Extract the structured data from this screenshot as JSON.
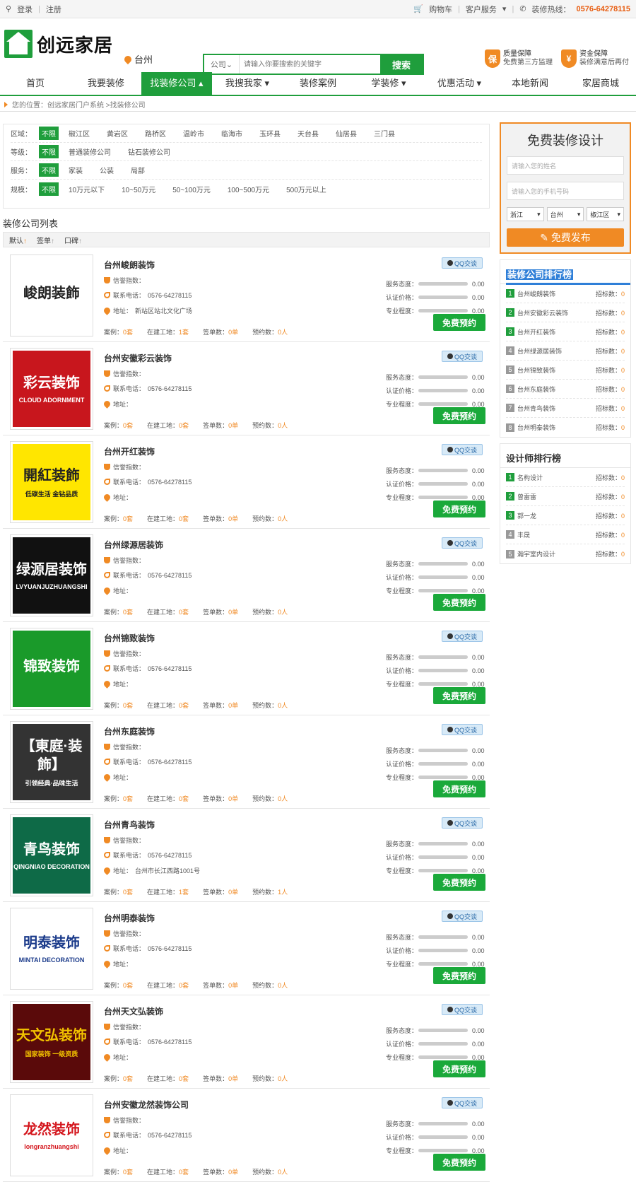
{
  "topbar": {
    "login": "登录",
    "register": "注册",
    "cart": "购物车",
    "service": "客户服务",
    "hotline_label": "装修热线：",
    "hotline_number": "0576-64278115"
  },
  "header": {
    "logo_text": "创远家居",
    "city": "台州",
    "search_category": "公司",
    "search_placeholder": "请输入你要搜索的关键字",
    "search_button": "搜索",
    "guarantees": [
      {
        "icon": "保",
        "title": "质量保障",
        "desc": "免费第三方监理"
      },
      {
        "icon": "¥",
        "title": "资金保障",
        "desc": "装修满意后再付"
      }
    ]
  },
  "nav": [
    "首页",
    "我要装修",
    "找装修公司",
    "我搜我家",
    "装修案例",
    "学装修",
    "优惠活动",
    "本地新闻",
    "家居商城"
  ],
  "breadcrumb": "您的位置：创远家居门户系统 >找装修公司",
  "filters": [
    {
      "label": "区域：",
      "tag": "不限",
      "options": [
        "椒江区",
        "黄岩区",
        "路桥区",
        "温岭市",
        "临海市",
        "玉环县",
        "天台县",
        "仙居县",
        "三门县"
      ]
    },
    {
      "label": "等级：",
      "tag": "不限",
      "options": [
        "普通装修公司",
        "钻石装修公司"
      ]
    },
    {
      "label": "服务：",
      "tag": "不限",
      "options": [
        "家装",
        "公装",
        "局部"
      ]
    },
    {
      "label": "规模：",
      "tag": "不限",
      "options": [
        "10万元以下",
        "10~50万元",
        "50~100万元",
        "100~500万元",
        "500万元以上"
      ]
    }
  ],
  "list_title": "装修公司列表",
  "sort": [
    "默认",
    "签单",
    "口碑"
  ],
  "card_labels": {
    "credit": "信誉指数：",
    "phone": "联系电话：",
    "address": "地址：",
    "cases": "案例：",
    "sites": "在建工地：",
    "signed": "签单数：",
    "booked": "预约数：",
    "service": "服务态度：",
    "price": "认证价格：",
    "pro": "专业程度：",
    "qq": "QQ交谈",
    "book": "免费预约"
  },
  "companies": [
    {
      "name": "台州峻朗装饰",
      "phone": "0576-64278115",
      "address": "新站区站北文化广场",
      "cases": "0套",
      "sites": "1套",
      "signed": "0单",
      "booked": "0人",
      "service": "0.00",
      "price": "0.00",
      "pro": "0.00",
      "logo": "峻朗装飾",
      "logo_sub": "",
      "logo_bg": "#ffffff",
      "logo_fg": "#222222"
    },
    {
      "name": "台州安徽彩云装饰",
      "phone": "0576-64278115",
      "address": "",
      "cases": "0套",
      "sites": "0套",
      "signed": "0单",
      "booked": "0人",
      "service": "0.00",
      "price": "0.00",
      "pro": "0.00",
      "logo": "彩云装饰",
      "logo_sub": "CLOUD ADORNMENT",
      "logo_bg": "#c8161d",
      "logo_fg": "#ffffff"
    },
    {
      "name": "台州开红装饰",
      "phone": "0576-64278115",
      "address": "",
      "cases": "0套",
      "sites": "0套",
      "signed": "0单",
      "booked": "0人",
      "service": "0.00",
      "price": "0.00",
      "pro": "0.00",
      "logo": "開紅装飾",
      "logo_sub": "低碳生活 金钻品质",
      "logo_bg": "#ffe600",
      "logo_fg": "#222222"
    },
    {
      "name": "台州绿源居装饰",
      "phone": "0576-64278115",
      "address": "",
      "cases": "0套",
      "sites": "0套",
      "signed": "0单",
      "booked": "0人",
      "service": "0.00",
      "price": "0.00",
      "pro": "0.00",
      "logo": "绿源居装饰",
      "logo_sub": "LVYUANJUZHUANGSHI",
      "logo_bg": "#111111",
      "logo_fg": "#ffffff"
    },
    {
      "name": "台州锦致装饰",
      "phone": "0576-64278115",
      "address": "",
      "cases": "0套",
      "sites": "0套",
      "signed": "0单",
      "booked": "0人",
      "service": "0.00",
      "price": "0.00",
      "pro": "0.00",
      "logo": "锦致装饰",
      "logo_sub": "",
      "logo_bg": "#1a9a2a",
      "logo_fg": "#ffffff"
    },
    {
      "name": "台州东庭装饰",
      "phone": "0576-64278115",
      "address": "",
      "cases": "0套",
      "sites": "0套",
      "signed": "0单",
      "booked": "0人",
      "service": "0.00",
      "price": "0.00",
      "pro": "0.00",
      "logo": "【東庭·装飾】",
      "logo_sub": "引领经典·品味生活",
      "logo_bg": "#333333",
      "logo_fg": "#ffffff"
    },
    {
      "name": "台州青鸟装饰",
      "phone": "0576-64278115",
      "address": "台州市长江西路1001号",
      "cases": "0套",
      "sites": "1套",
      "signed": "0单",
      "booked": "1人",
      "service": "0.00",
      "price": "0.00",
      "pro": "0.00",
      "logo": "青鸟装饰",
      "logo_sub": "QINGNIAO DECORATION",
      "logo_bg": "#0e6a47",
      "logo_fg": "#ffffff"
    },
    {
      "name": "台州明泰装饰",
      "phone": "0576-64278115",
      "address": "",
      "cases": "0套",
      "sites": "0套",
      "signed": "0单",
      "booked": "0人",
      "service": "0.00",
      "price": "0.00",
      "pro": "0.00",
      "logo": "明泰装饰",
      "logo_sub": "MINTAI DECORATION",
      "logo_bg": "#ffffff",
      "logo_fg": "#1a3a8a"
    },
    {
      "name": "台州天文弘装饰",
      "phone": "0576-64278115",
      "address": "",
      "cases": "0套",
      "sites": "0套",
      "signed": "0单",
      "booked": "0人",
      "service": "0.00",
      "price": "0.00",
      "pro": "0.00",
      "logo": "天文弘装饰",
      "logo_sub": "国家装饰 一级资质",
      "logo_bg": "#5a0a0a",
      "logo_fg": "#f2c200"
    },
    {
      "name": "台州安徽龙然装饰公司",
      "phone": "0576-64278115",
      "address": "",
      "cases": "0套",
      "sites": "0套",
      "signed": "0单",
      "booked": "0人",
      "service": "0.00",
      "price": "0.00",
      "pro": "0.00",
      "logo": "龙然装饰",
      "logo_sub": "longranzhuangshi",
      "logo_bg": "#ffffff",
      "logo_fg": "#d4161d"
    }
  ],
  "sidebar": {
    "design_title": "免费装修设计",
    "name_placeholder": "请输入您的姓名",
    "phone_placeholder": "请输入您的手机号码",
    "province": "浙江",
    "city": "台州",
    "district": "椒江区",
    "publish": "免费发布",
    "company_rank_title": "装修公司排行榜",
    "company_rank": [
      {
        "num": "1",
        "name": "台州峻朗装饰",
        "count": "0"
      },
      {
        "num": "2",
        "name": "台州安徽彩云装饰",
        "count": "0"
      },
      {
        "num": "3",
        "name": "台州开红装饰",
        "count": "0"
      },
      {
        "num": "4",
        "name": "台州绿源居装饰",
        "count": "0"
      },
      {
        "num": "5",
        "name": "台州锦致装饰",
        "count": "0"
      },
      {
        "num": "6",
        "name": "台州东庭装饰",
        "count": "0"
      },
      {
        "num": "7",
        "name": "台州青鸟装饰",
        "count": "0"
      },
      {
        "num": "8",
        "name": "台州明泰装饰",
        "count": "0"
      }
    ],
    "designer_rank_title": "设计师排行榜",
    "designer_rank": [
      {
        "num": "1",
        "name": "名构设计",
        "count": "0"
      },
      {
        "num": "2",
        "name": "曾雷雷",
        "count": "0"
      },
      {
        "num": "3",
        "name": "郭一龙",
        "count": "0"
      },
      {
        "num": "4",
        "name": "丰晟",
        "count": "0"
      },
      {
        "num": "5",
        "name": "瀚宇室内设计",
        "count": "0"
      }
    ],
    "count_label": "招标数："
  },
  "colors": {
    "green": "#1f9e3c",
    "orange": "#f08a24",
    "blue": "#2f7fd8"
  }
}
